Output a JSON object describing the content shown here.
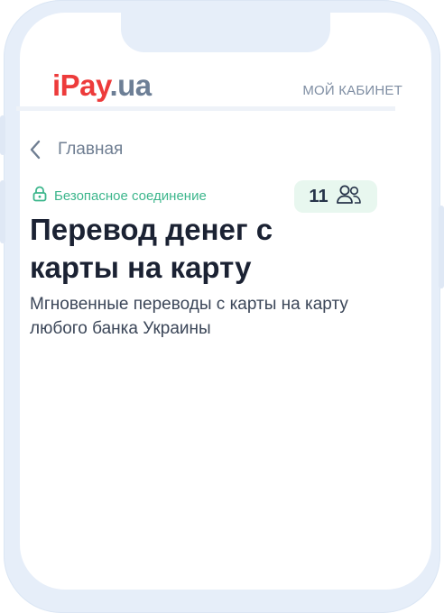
{
  "header": {
    "logo": {
      "part1": "iPay",
      "part2": ".ua"
    },
    "cabinet_link": "МОЙ КАБИНЕТ"
  },
  "breadcrumb": {
    "back_label": "Главная",
    "icon": "chevron-left-icon"
  },
  "security": {
    "icon": "lock-icon",
    "label": "Безопасное соединение"
  },
  "online_users": {
    "count": "11",
    "icon": "users-icon"
  },
  "page": {
    "title": "Перевод денег с карты на карту",
    "subtitle": "Мгновенные переводы с карты на карту любого банка Украины"
  },
  "colors": {
    "brand_red": "#ed3b3b",
    "brand_gray": "#6d7f96",
    "secure_green": "#3cb68c",
    "badge_bg": "#e8f7ef",
    "title_dark": "#1b2233"
  }
}
